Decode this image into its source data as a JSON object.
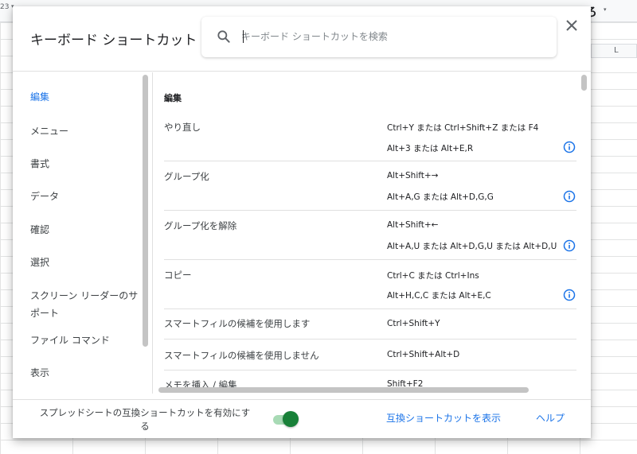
{
  "background": {
    "zoom_label": "23",
    "top_glyph": "ろ",
    "column_label": "L"
  },
  "dialog": {
    "title": "キーボード ショートカット",
    "search": {
      "placeholder": "キーボード ショートカットを検索",
      "value": ""
    }
  },
  "nav": {
    "items": [
      {
        "label": "編集",
        "active": true
      },
      {
        "label": "メニュー",
        "active": false
      },
      {
        "label": "書式",
        "active": false
      },
      {
        "label": "データ",
        "active": false
      },
      {
        "label": "確認",
        "active": false
      },
      {
        "label": "選択",
        "active": false
      },
      {
        "label": "スクリーン リーダーのサポート",
        "active": false
      },
      {
        "label": "ファイル コマンド",
        "active": false
      },
      {
        "label": "表示",
        "active": false
      }
    ]
  },
  "content": {
    "section_title": "編集",
    "rows": [
      {
        "name": "やり直し",
        "keys": [
          "Ctrl+Y または Ctrl+Shift+Z または F4",
          "Alt+3 または Alt+E,R"
        ],
        "info": true
      },
      {
        "name": "グループ化",
        "keys": [
          "Alt+Shift+→",
          "Alt+A,G または Alt+D,G,G"
        ],
        "info": true
      },
      {
        "name": "グループ化を解除",
        "keys": [
          "Alt+Shift+←",
          "Alt+A,U または Alt+D,G,U または Alt+D,U"
        ],
        "info": true
      },
      {
        "name": "コピー",
        "keys": [
          "Ctrl+C または Ctrl+Ins",
          "Alt+H,C,C または Alt+E,C"
        ],
        "info": true
      },
      {
        "name": "スマートフィルの候補を使用します",
        "keys": [
          "Ctrl+Shift+Y"
        ],
        "info": false
      },
      {
        "name": "スマートフィルの候補を使用しません",
        "keys": [
          "Ctrl+Shift+Alt+D"
        ],
        "info": false
      },
      {
        "name": "メモを挿入 / 編集",
        "keys": [
          "Shift+F2"
        ],
        "info": false
      }
    ]
  },
  "footer": {
    "compat_label": "スプレッドシートの互換ショートカットを有効にする",
    "compat_enabled": true,
    "show_compat_link": "互換ショートカットを表示",
    "help_link": "ヘルプ"
  },
  "colors": {
    "accent": "#1a73e8",
    "toggle_on": "#188038",
    "toggle_track": "#a8dab5"
  }
}
